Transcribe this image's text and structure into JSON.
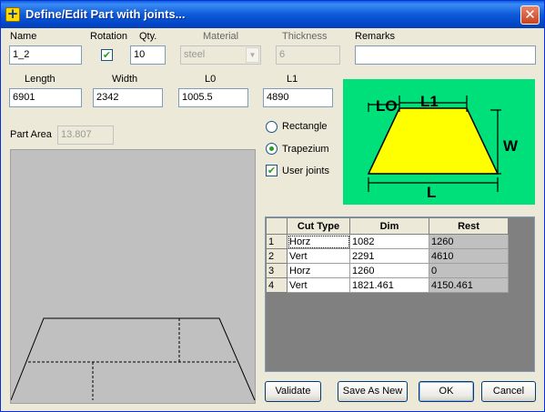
{
  "window": {
    "title": "Define/Edit Part with joints...",
    "close_symbol": "✕",
    "icon_symbol": "+"
  },
  "name": {
    "label": "Name",
    "value": "1_2"
  },
  "rotation": {
    "label": "Rotation",
    "checked": true,
    "check_glyph": "✔"
  },
  "qty": {
    "label": "Qty.",
    "value": "10"
  },
  "material": {
    "label": "Material",
    "value": "steel"
  },
  "thickness": {
    "label": "Thickness",
    "value": "6"
  },
  "remarks": {
    "label": "Remarks",
    "value": ""
  },
  "length": {
    "label": "Length",
    "value": "6901"
  },
  "width": {
    "label": "Width",
    "value": "2342"
  },
  "l0": {
    "label": "L0",
    "value": "1005.5"
  },
  "l1": {
    "label": "L1",
    "value": "4890"
  },
  "part_area": {
    "label": "Part Area",
    "value": "13.807"
  },
  "shape_options": {
    "rectangle": {
      "label": "Rectangle",
      "selected": false
    },
    "trapezium": {
      "label": "Trapezium",
      "selected": true
    },
    "user_joints": {
      "label": "User joints",
      "checked": true,
      "check_glyph": "✔"
    }
  },
  "diagram": {
    "l0_label": "LO",
    "l1_label": "L1",
    "w_label": "W",
    "l_label": "L",
    "bg_color": "#00e07a",
    "shape_color": "#ffff00"
  },
  "joints_grid": {
    "columns": [
      "Cut Type",
      "Dim",
      "Rest"
    ],
    "rows": [
      {
        "n": "1",
        "cut_type": "Horz",
        "dim": "1082",
        "rest": "1260"
      },
      {
        "n": "2",
        "cut_type": "Vert",
        "dim": "2291",
        "rest": "4610"
      },
      {
        "n": "3",
        "cut_type": "Horz",
        "dim": "1260",
        "rest": "0"
      },
      {
        "n": "4",
        "cut_type": "Vert",
        "dim": "1821.461",
        "rest": "4150.461"
      }
    ]
  },
  "buttons": {
    "validate": "Validate",
    "save_as_new": "Save As New",
    "ok": "OK",
    "cancel": "Cancel"
  }
}
